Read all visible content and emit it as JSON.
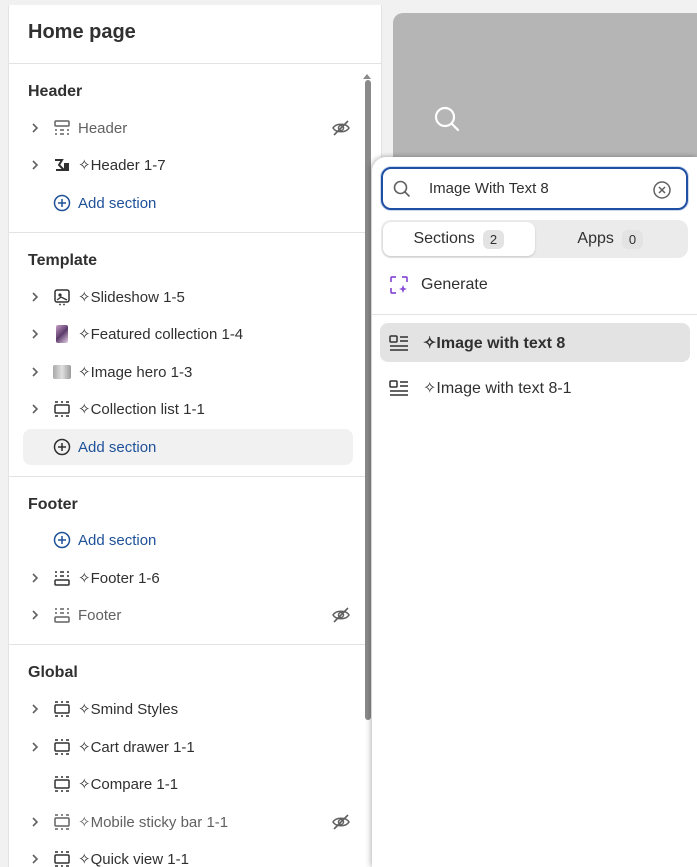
{
  "left_panel": {
    "title": "Home page",
    "groups": {
      "header": {
        "heading": "Header",
        "items": [
          "Header",
          "✧Header 1-7"
        ],
        "add_label": "Add section"
      },
      "template": {
        "heading": "Template",
        "items": [
          "✧Slideshow 1-5",
          "✧Featured collection 1-4",
          "✧Image hero 1-3",
          "✧Collection list 1-1"
        ],
        "add_label": "Add section"
      },
      "footer": {
        "heading": "Footer",
        "add_label": "Add section",
        "items": [
          "✧Footer 1-6",
          "Footer"
        ]
      },
      "global": {
        "heading": "Global",
        "items": [
          "✧Smind Styles",
          "✧Cart drawer 1-1",
          "✧Compare 1-1",
          "✧Mobile sticky bar 1-1",
          "✧Quick view 1-1"
        ]
      }
    }
  },
  "popover": {
    "search_value": "Image With Text 8",
    "tabs": [
      {
        "label": "Sections",
        "count": "2"
      },
      {
        "label": "Apps",
        "count": "0"
      }
    ],
    "generate_label": "Generate",
    "results": [
      "✧Image with text 8",
      "✧Image with text 8-1"
    ]
  },
  "colors": {
    "accent": "#1f5199",
    "generate_icon": "#8a4dd6",
    "preview_bg": "#b5b5b5"
  },
  "icons": [
    "chevron-right-icon",
    "section-icon",
    "eye-hidden-icon",
    "plus-circle-icon",
    "search-icon",
    "clear-icon",
    "generate-sparkle-icon",
    "image-text-section-icon"
  ]
}
